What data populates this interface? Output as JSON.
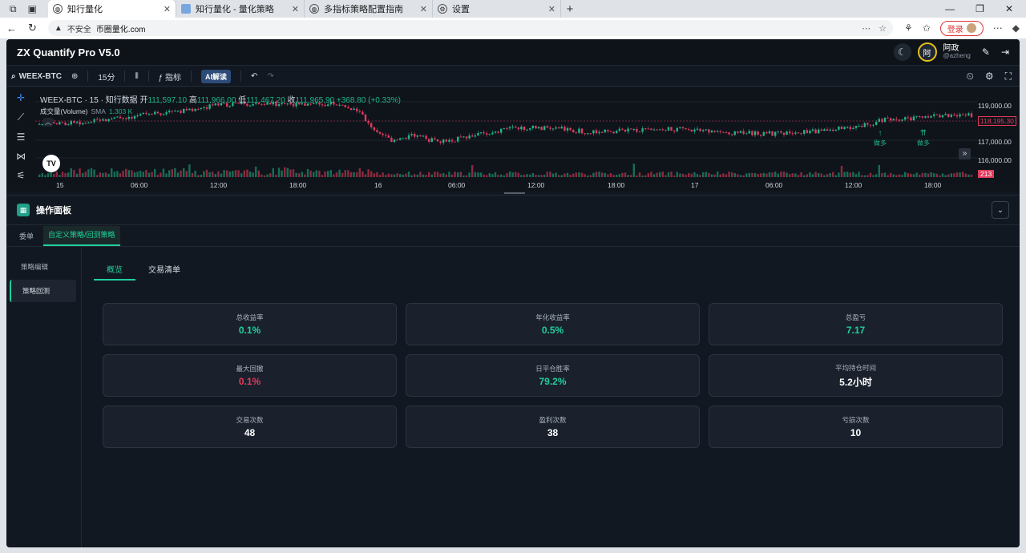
{
  "browser": {
    "tabs": [
      {
        "title": "知行量化",
        "active": true
      },
      {
        "title": "知行量化 - 量化策略",
        "active": false
      },
      {
        "title": "多指标策略配置指南",
        "active": false
      },
      {
        "title": "设置",
        "active": false
      }
    ],
    "security": "不安全",
    "url": "币圈量化.com",
    "login_label": "登录"
  },
  "app": {
    "title": "ZX Quantify Pro V5.0",
    "user": {
      "avatar_text": "阿",
      "name": "阿政",
      "handle": "@azheng"
    }
  },
  "toolbar": {
    "symbol": "WEEX-BTC",
    "interval": "15分",
    "indicator_label": "指标",
    "ai_label": "AI解读"
  },
  "chart": {
    "legend": {
      "title": "WEEX-BTC · 15 · 知行数据",
      "open_label": "开",
      "open": "111,597.10",
      "high_label": "高",
      "high": "111,966.00",
      "low_label": "低",
      "low": "111,467.20",
      "close_label": "收",
      "close": "111,965.90",
      "change": "+368.80 (+0.33%)"
    },
    "volume_legend": {
      "name": "成交量(Volume)",
      "sma": "SMA",
      "value": "1.303 K"
    },
    "logo_text": "TV",
    "price_ticks": [
      "119,000.00",
      "117,000.00",
      "116,000.00"
    ],
    "last_price": "118,195.30",
    "last_volume": "213",
    "time_ticks": [
      "15",
      "06:00",
      "12:00",
      "18:00",
      "16",
      "06:00",
      "12:00",
      "18:00",
      "17",
      "06:00",
      "12:00",
      "18:00"
    ],
    "annotations": [
      {
        "label": "做多"
      },
      {
        "label": "做多"
      }
    ],
    "colors": {
      "up": "#1fb58a",
      "down": "#e23a5c"
    }
  },
  "panel": {
    "title": "操作面板",
    "subtabs": [
      "委单",
      "自定义策略/回测策略"
    ],
    "active_subtab": 1,
    "side_items": [
      "策略编辑",
      "策略回测"
    ],
    "active_side": 1,
    "content_tabs": [
      "概览",
      "交易清单"
    ],
    "active_content_tab": 0,
    "metrics": [
      {
        "label": "总收益率",
        "value": "0.1%",
        "tone": "green"
      },
      {
        "label": "年化收益率",
        "value": "0.5%",
        "tone": "green"
      },
      {
        "label": "总盈亏",
        "value": "7.17",
        "tone": "green"
      },
      {
        "label": "最大回撤",
        "value": "0.1%",
        "tone": "red"
      },
      {
        "label": "日平仓胜率",
        "value": "79.2%",
        "tone": "green"
      },
      {
        "label": "平均持仓时间",
        "value": "5.2小时",
        "tone": "white"
      },
      {
        "label": "交易次数",
        "value": "48",
        "tone": "white"
      },
      {
        "label": "盈利次数",
        "value": "38",
        "tone": "white"
      },
      {
        "label": "亏损次数",
        "value": "10",
        "tone": "white"
      }
    ]
  },
  "icons": {
    "menu": "grid-icon",
    "search": "search-icon",
    "add": "plus-icon",
    "undo": "undo-icon",
    "redo": "redo-icon",
    "moon": "moon-icon",
    "edit": "pencil-icon",
    "logout": "logout-icon"
  }
}
